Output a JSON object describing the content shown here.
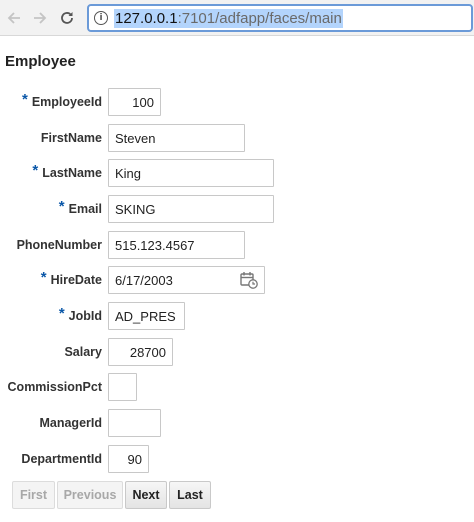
{
  "browser": {
    "url_host": "127.0.0.1",
    "url_rest": ":7101/adfapp/faces/main"
  },
  "page": {
    "title": "Employee"
  },
  "form": {
    "required_marker": "*",
    "fields": [
      {
        "label": "EmployeeId",
        "value": "100",
        "required": true
      },
      {
        "label": "FirstName",
        "value": "Steven",
        "required": false
      },
      {
        "label": "LastName",
        "value": "King",
        "required": true
      },
      {
        "label": "Email",
        "value": "SKING",
        "required": true
      },
      {
        "label": "PhoneNumber",
        "value": "515.123.4567",
        "required": false
      },
      {
        "label": "HireDate",
        "value": "6/17/2003",
        "required": true
      },
      {
        "label": "JobId",
        "value": "AD_PRES",
        "required": true
      },
      {
        "label": "Salary",
        "value": "28700",
        "required": false
      },
      {
        "label": "CommissionPct",
        "value": "",
        "required": false
      },
      {
        "label": "ManagerId",
        "value": "",
        "required": false
      },
      {
        "label": "DepartmentId",
        "value": "90",
        "required": false
      }
    ]
  },
  "buttons": {
    "first": "First",
    "previous": "Previous",
    "next": "Next",
    "last": "Last"
  },
  "icons": {
    "back": "back-arrow-icon",
    "forward": "forward-arrow-icon",
    "reload": "reload-icon",
    "site_info": "info-icon",
    "calendar": "calendar-icon"
  },
  "colors": {
    "required_marker": "#0a57a8",
    "url_focus_border": "#6b9ad8",
    "url_selection": "#b3d4fc"
  }
}
